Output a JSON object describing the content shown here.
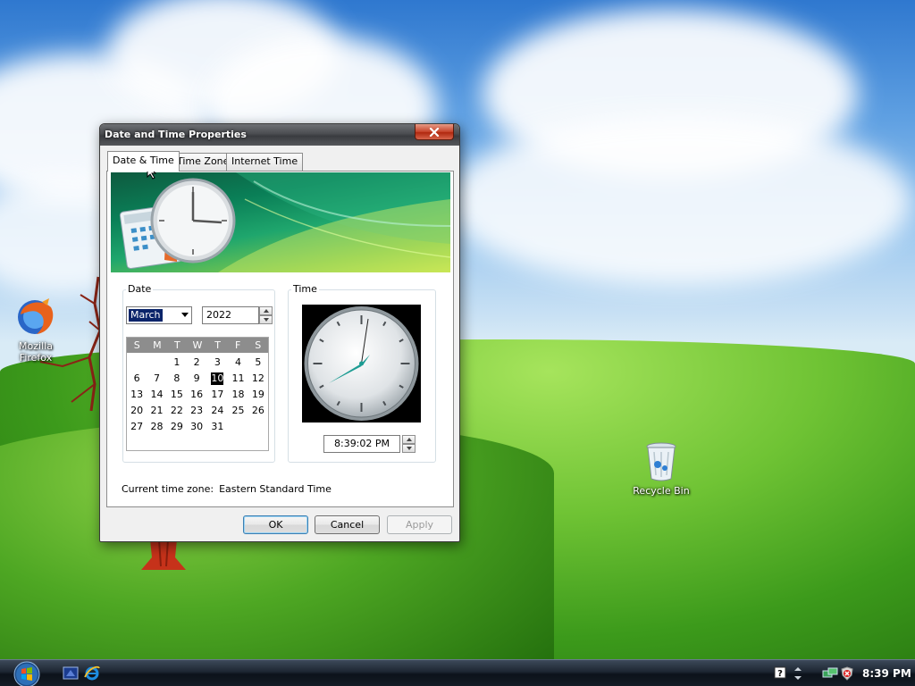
{
  "desktop": {
    "icons": [
      {
        "label": "Mozilla Firefox"
      },
      {
        "label": "Recycle Bin"
      }
    ]
  },
  "dialog": {
    "title": "Date and Time Properties",
    "tabs": [
      {
        "label": "Date & Time",
        "active": true
      },
      {
        "label": "Time Zone",
        "active": false
      },
      {
        "label": "Internet Time",
        "active": false
      }
    ],
    "date_group_label": "Date",
    "time_group_label": "Time",
    "month": "March",
    "year": "2022",
    "weekdays": [
      "S",
      "M",
      "T",
      "W",
      "T",
      "F",
      "S"
    ],
    "calendar_rows": [
      [
        "",
        "",
        "1",
        "2",
        "3",
        "4",
        "5"
      ],
      [
        "6",
        "7",
        "8",
        "9",
        "10",
        "11",
        "12"
      ],
      [
        "13",
        "14",
        "15",
        "16",
        "17",
        "18",
        "19"
      ],
      [
        "20",
        "21",
        "22",
        "23",
        "24",
        "25",
        "26"
      ],
      [
        "27",
        "28",
        "29",
        "30",
        "31",
        "",
        ""
      ]
    ],
    "selected_day": "10",
    "time_value": "8:39:02 PM",
    "current_tz_label": "Current time zone:",
    "current_tz_value": "Eastern Standard Time",
    "buttons": {
      "ok": "OK",
      "cancel": "Cancel",
      "apply": "Apply"
    }
  },
  "taskbar": {
    "clock": "8:39 PM",
    "quick_launch": [
      "show-desktop-icon",
      "internet-explorer-icon"
    ],
    "tray_icons": [
      "help-icon",
      "network-icon",
      "security-shield-icon"
    ]
  },
  "colors": {
    "selection": "#0a246a",
    "taskbar": "#1d2632",
    "titlebar": "#4b4d51",
    "close_button": "#c7452c"
  }
}
